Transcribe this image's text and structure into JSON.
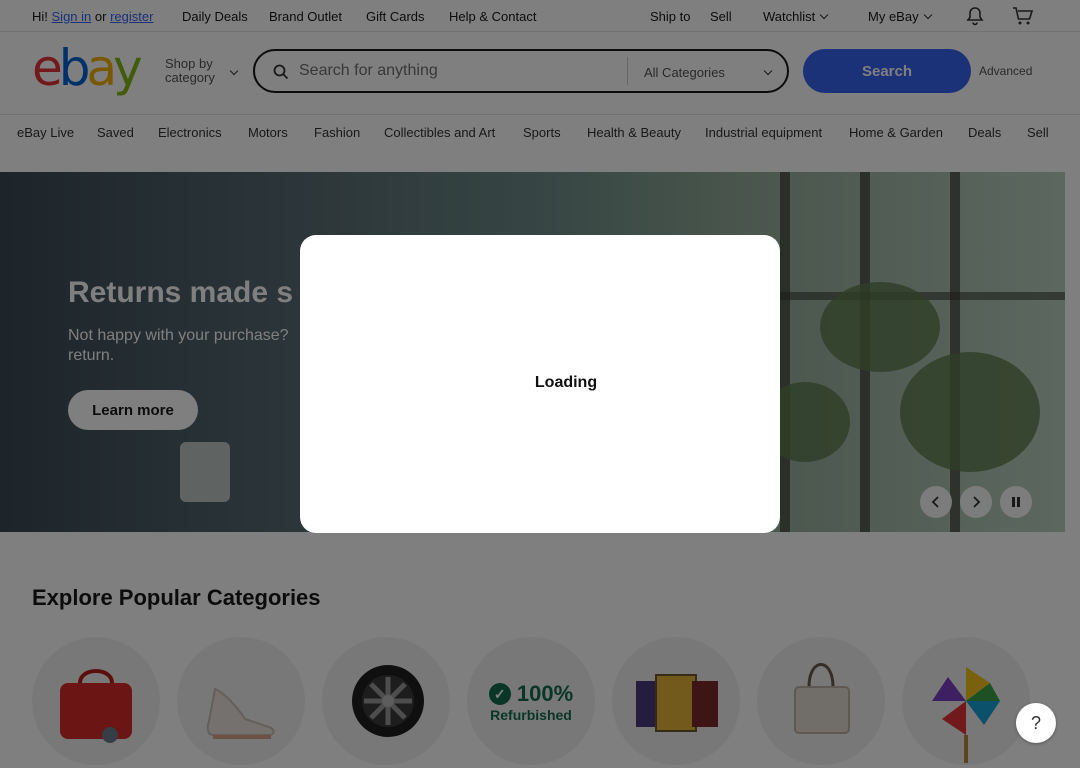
{
  "topbar": {
    "greeting_prefix": "Hi!",
    "sign_in": "Sign in",
    "or": "or",
    "register": "register",
    "links": [
      "Daily Deals",
      "Brand Outlet",
      "Gift Cards",
      "Help & Contact"
    ],
    "ship_to": "Ship to",
    "sell": "Sell",
    "watchlist": "Watchlist",
    "my_ebay": "My eBay"
  },
  "header": {
    "logo": {
      "e": "e",
      "b": "b",
      "a": "a",
      "y": "y"
    },
    "shop_by_1": "Shop by",
    "shop_by_2": "category",
    "search_placeholder": "Search for anything",
    "category_select": "All Categories",
    "search_button": "Search",
    "advanced": "Advanced"
  },
  "nav": {
    "items": [
      "eBay Live",
      "Saved",
      "Electronics",
      "Motors",
      "Fashion",
      "Collectibles and Art",
      "Sports",
      "Health & Beauty",
      "Industrial equipment",
      "Home & Garden",
      "Deals",
      "Sell"
    ]
  },
  "hero": {
    "title": "Returns made s",
    "subtitle": "Not happy with your purchase? return.",
    "button": "Learn more"
  },
  "categories": {
    "title": "Explore Popular Categories",
    "refurb_big": "100%",
    "refurb_small": "Refurbished"
  },
  "modal": {
    "text": "Loading"
  },
  "help": "?",
  "colors": {
    "brand_blue": "#3665f3",
    "logo_red": "#e53238",
    "logo_blue": "#0064d2",
    "logo_yellow": "#f5af02",
    "logo_green": "#86b817"
  }
}
